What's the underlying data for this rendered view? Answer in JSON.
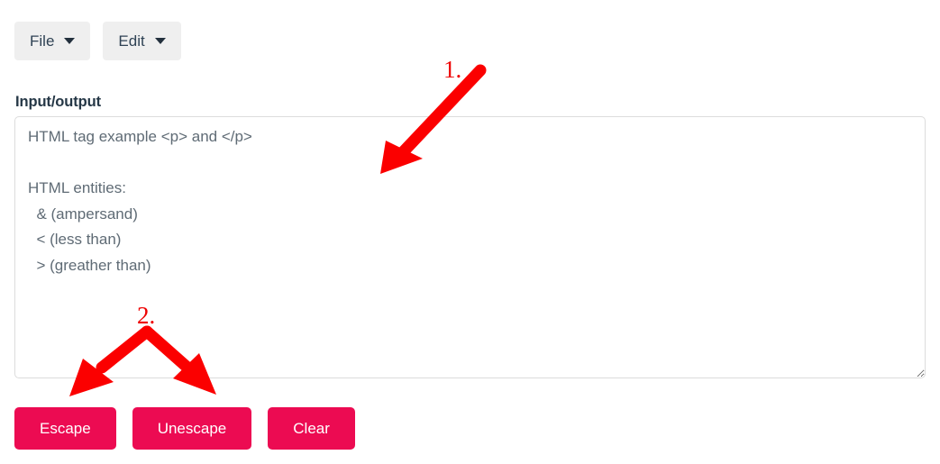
{
  "menubar": {
    "items": [
      {
        "label": "File",
        "icon": "chevron-down-icon"
      },
      {
        "label": "Edit",
        "icon": "chevron-down-icon"
      }
    ]
  },
  "form": {
    "label": "Input/output",
    "textarea": {
      "value": "HTML tag example <p> and </p>\n\nHTML entities:\n  & (ampersand)\n  < (less than)\n  > (greather than)",
      "placeholder": "",
      "resize_handle": "resize-grip-icon"
    }
  },
  "actions": {
    "buttons": [
      {
        "label": "Escape",
        "color": "#ec0b52"
      },
      {
        "label": "Unescape",
        "color": "#ec0b52"
      },
      {
        "label": "Clear",
        "color": "#ec0b52"
      }
    ]
  },
  "annotations": {
    "arrow_color": "#fb0000",
    "label_color": "#ee0000",
    "items": [
      {
        "label": "1.",
        "kind": "single-arrow",
        "points_to": "input-output-textarea"
      },
      {
        "label": "2.",
        "kind": "double-arrow",
        "points_to": "escape-and-unescape-buttons"
      }
    ]
  },
  "colors": {
    "menu_button_bg": "#efefef",
    "text_dark": "#253746",
    "textarea_text": "#5f6b75",
    "textarea_border": "#dcdcdc",
    "accent": "#ec0b52"
  }
}
